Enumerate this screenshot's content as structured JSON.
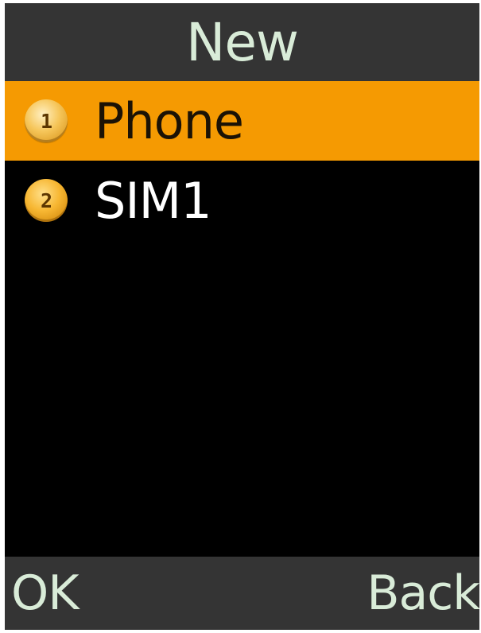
{
  "screen": {
    "title": "New"
  },
  "menu": {
    "items": [
      {
        "number": "1",
        "label": "Phone",
        "selected": true
      },
      {
        "number": "2",
        "label": "SIM1",
        "selected": false
      }
    ]
  },
  "softkeys": {
    "left_label": "OK",
    "right_label": "Back"
  },
  "colors": {
    "bar_background": "#343434",
    "screen_background": "#000000",
    "selection_highlight": "#f59a02",
    "bar_text": "#d9ecd8",
    "item_text": "#ffffff"
  },
  "icons": {
    "item_number_badge": "orange-number-circle-icon"
  }
}
